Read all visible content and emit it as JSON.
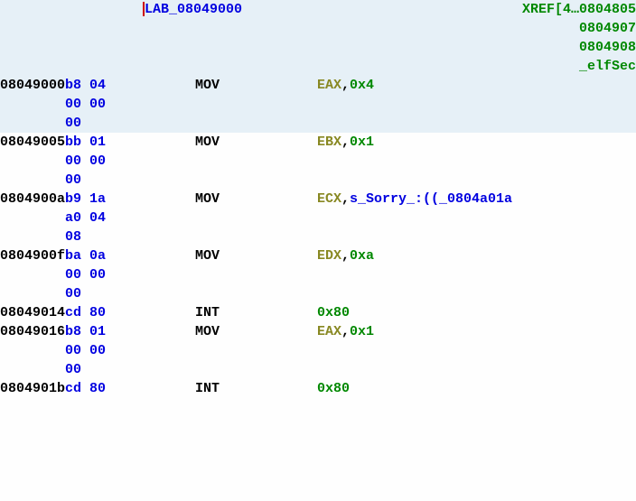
{
  "header": {
    "label": "LAB_08049000",
    "xref_prefix": "XREF[4…",
    "xrefs": [
      "0804805",
      "0804907",
      "0804908",
      "_elfSec"
    ]
  },
  "lines": [
    {
      "addr": "08049000",
      "bytes": [
        "b8 04",
        "00 00",
        "00"
      ],
      "mnemonic": "MOV",
      "op_reg": "EAX",
      "op_sep": ",",
      "op_imm": "0x4",
      "hl": true
    },
    {
      "addr": "08049005",
      "bytes": [
        "bb 01",
        "00 00",
        "00"
      ],
      "mnemonic": "MOV",
      "op_reg": "EBX",
      "op_sep": ",",
      "op_imm": "0x1",
      "hl": false
    },
    {
      "addr": "0804900a",
      "bytes": [
        "b9 1a",
        "a0 04",
        "08"
      ],
      "mnemonic": "MOV",
      "op_reg": "ECX",
      "op_sep": ",",
      "op_ref": "s_Sorry_:((_0804a01a",
      "hl": false
    },
    {
      "addr": "0804900f",
      "bytes": [
        "ba 0a",
        "00 00",
        "00"
      ],
      "mnemonic": "MOV",
      "op_reg": "EDX",
      "op_sep": ",",
      "op_imm": "0xa",
      "hl": false
    },
    {
      "addr": "08049014",
      "bytes": [
        "cd 80"
      ],
      "mnemonic": "INT",
      "op_imm": "0x80",
      "hl": false
    },
    {
      "addr": "08049016",
      "bytes": [
        "b8 01",
        "00 00",
        "00"
      ],
      "mnemonic": "MOV",
      "op_reg": "EAX",
      "op_sep": ",",
      "op_imm": "0x1",
      "hl": false
    },
    {
      "addr": "0804901b",
      "bytes": [
        "cd 80"
      ],
      "mnemonic": "INT",
      "op_imm": "0x80",
      "hl": false
    }
  ]
}
